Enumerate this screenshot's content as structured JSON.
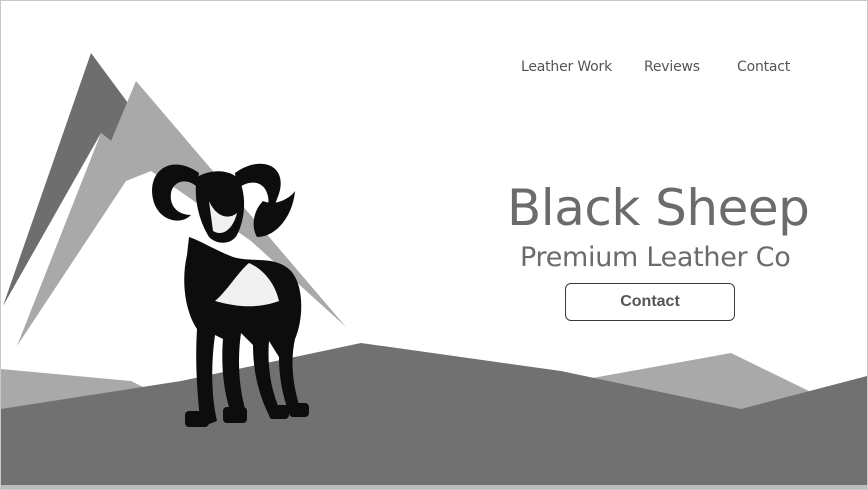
{
  "nav": {
    "items": [
      {
        "label": "Leather Work"
      },
      {
        "label": "Reviews"
      },
      {
        "label": "Contact"
      }
    ]
  },
  "hero": {
    "title": "Black Sheep",
    "subtitle": "Premium Leather Co",
    "cta_label": "Contact"
  },
  "icons": {
    "logo": "ram-icon"
  },
  "colors": {
    "mountain_dark": "#6e6e6e",
    "mountain_light": "#a9a9a9",
    "ground": "#717171",
    "text": "#6b6b6b"
  }
}
